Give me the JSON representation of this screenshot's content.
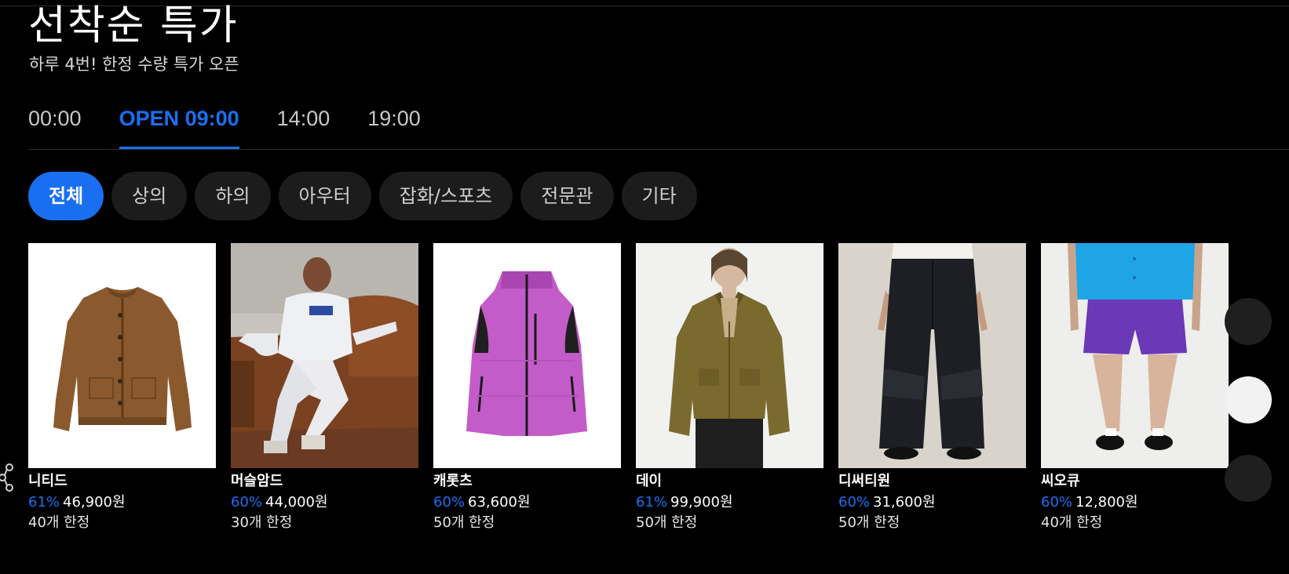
{
  "header": {
    "title": "선착순 특가",
    "subtitle": "하루 4번! 한정 수량 특가 오픈"
  },
  "time_tabs": [
    {
      "label": "00:00",
      "active": false
    },
    {
      "label": "OPEN 09:00",
      "active": true
    },
    {
      "label": "14:00",
      "active": false
    },
    {
      "label": "19:00",
      "active": false
    }
  ],
  "categories": [
    {
      "label": "전체",
      "active": true
    },
    {
      "label": "상의",
      "active": false
    },
    {
      "label": "하의",
      "active": false
    },
    {
      "label": "아우터",
      "active": false
    },
    {
      "label": "잡화/스포츠",
      "active": false
    },
    {
      "label": "전문관",
      "active": false
    },
    {
      "label": "기타",
      "active": false
    }
  ],
  "products": [
    {
      "name": "니티드",
      "discount": "61%",
      "price": "46,900원",
      "limit": "40개 한정",
      "image": "brown-knit-cardigan"
    },
    {
      "name": "머슬암드",
      "discount": "60%",
      "price": "44,000원",
      "limit": "30개 한정",
      "image": "man-white-tracksuit-on-sofa"
    },
    {
      "name": "캐롯츠",
      "discount": "60%",
      "price": "63,600원",
      "limit": "50개 한정",
      "image": "purple-padded-vest"
    },
    {
      "name": "데이",
      "discount": "61%",
      "price": "99,900원",
      "limit": "50개 한정",
      "image": "olive-wool-jacket"
    },
    {
      "name": "디써티원",
      "discount": "60%",
      "price": "31,600원",
      "limit": "50개 한정",
      "image": "black-cargo-pants"
    },
    {
      "name": "씨오큐",
      "discount": "60%",
      "price": "12,800원",
      "limit": "40개 한정",
      "image": "purple-shorts-blue-shirt"
    }
  ],
  "colors": {
    "accent": "#1a6ff0",
    "background": "#000000",
    "chip": "#1c1c1c"
  },
  "icons": {
    "share": "share-icon"
  }
}
